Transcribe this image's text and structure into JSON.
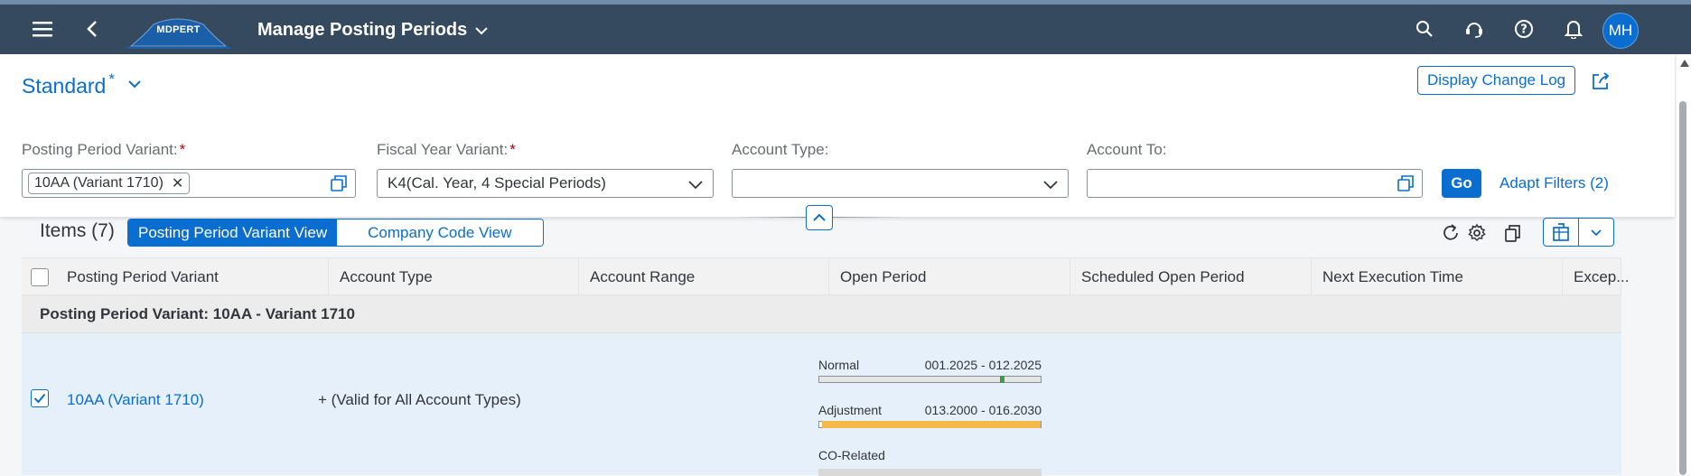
{
  "shell": {
    "logo_text": "MDPERT",
    "app_title": "Manage Posting Periods",
    "avatar_initials": "MH",
    "icons": [
      "menu-icon",
      "back-icon",
      "search-icon",
      "support-icon",
      "help-icon",
      "notification-icon"
    ]
  },
  "header": {
    "variant_name": "Standard",
    "variant_dirty_marker": "*",
    "display_change_log": "Display Change Log",
    "filters": {
      "posting_period_variant": {
        "label": "Posting Period Variant:",
        "required": "*",
        "token": "10AA (Variant 1710)",
        "token_remove": "✕"
      },
      "fiscal_year_variant": {
        "label": "Fiscal Year Variant:",
        "required": "*",
        "value": "K4(Cal. Year, 4 Special Periods)"
      },
      "account_type": {
        "label": "Account Type:",
        "value": ""
      },
      "account_to": {
        "label": "Account To:",
        "value": ""
      }
    },
    "go_label": "Go",
    "adapt_filters_label": "Adapt Filters (2)"
  },
  "table": {
    "items_title": "Items (7)",
    "views": [
      {
        "label": "Posting Period Variant View",
        "active": true
      },
      {
        "label": "Company Code View",
        "active": false
      }
    ],
    "columns": [
      "Posting Period Variant",
      "Account Type",
      "Account Range",
      "Open Period",
      "Scheduled Open Period",
      "Next Execution Time",
      "Excep..."
    ],
    "group_header": "Posting Period Variant: 10AA - Variant 1710",
    "rows": [
      {
        "selected": true,
        "variant": "10AA (Variant 1710)",
        "account_type": "+ (Valid for All Account Types)",
        "account_range": "",
        "open_periods": [
          {
            "label": "Normal",
            "range": "001.2025 - 012.2025"
          },
          {
            "label": "Adjustment",
            "range": "013.2000 - 016.2030"
          },
          {
            "label": "CO-Related",
            "range": ""
          }
        ]
      }
    ]
  },
  "colors": {
    "shell_bg": "#354a5f",
    "accent": "#0a6ed1",
    "required": "#bb0000",
    "normal_bar": "#3d9e4a",
    "adjustment_bar": "#f5b94a",
    "selected_row": "#e5f0fa"
  }
}
